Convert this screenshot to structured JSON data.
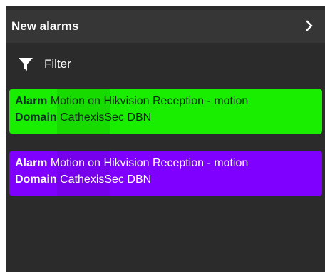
{
  "header": {
    "title": "New alarms",
    "expand_icon": "chevron-right-icon"
  },
  "filter": {
    "label": "Filter",
    "icon": "funnel-icon"
  },
  "alarms": [
    {
      "alarm_label": "Alarm",
      "alarm_text": "Motion on Hikvision Reception - motion",
      "domain_label": "Domain",
      "domain_text": "CathexisSec DBN",
      "color": "#19ee00"
    },
    {
      "alarm_label": "Alarm",
      "alarm_text": "Motion on Hikvision Reception - motion",
      "domain_label": "Domain",
      "domain_text": "CathexisSec DBN",
      "color": "#8000ff"
    }
  ],
  "colors": {
    "panel_bg": "#2b2b2b",
    "header_bg": "#363636",
    "text": "#ffffff"
  }
}
